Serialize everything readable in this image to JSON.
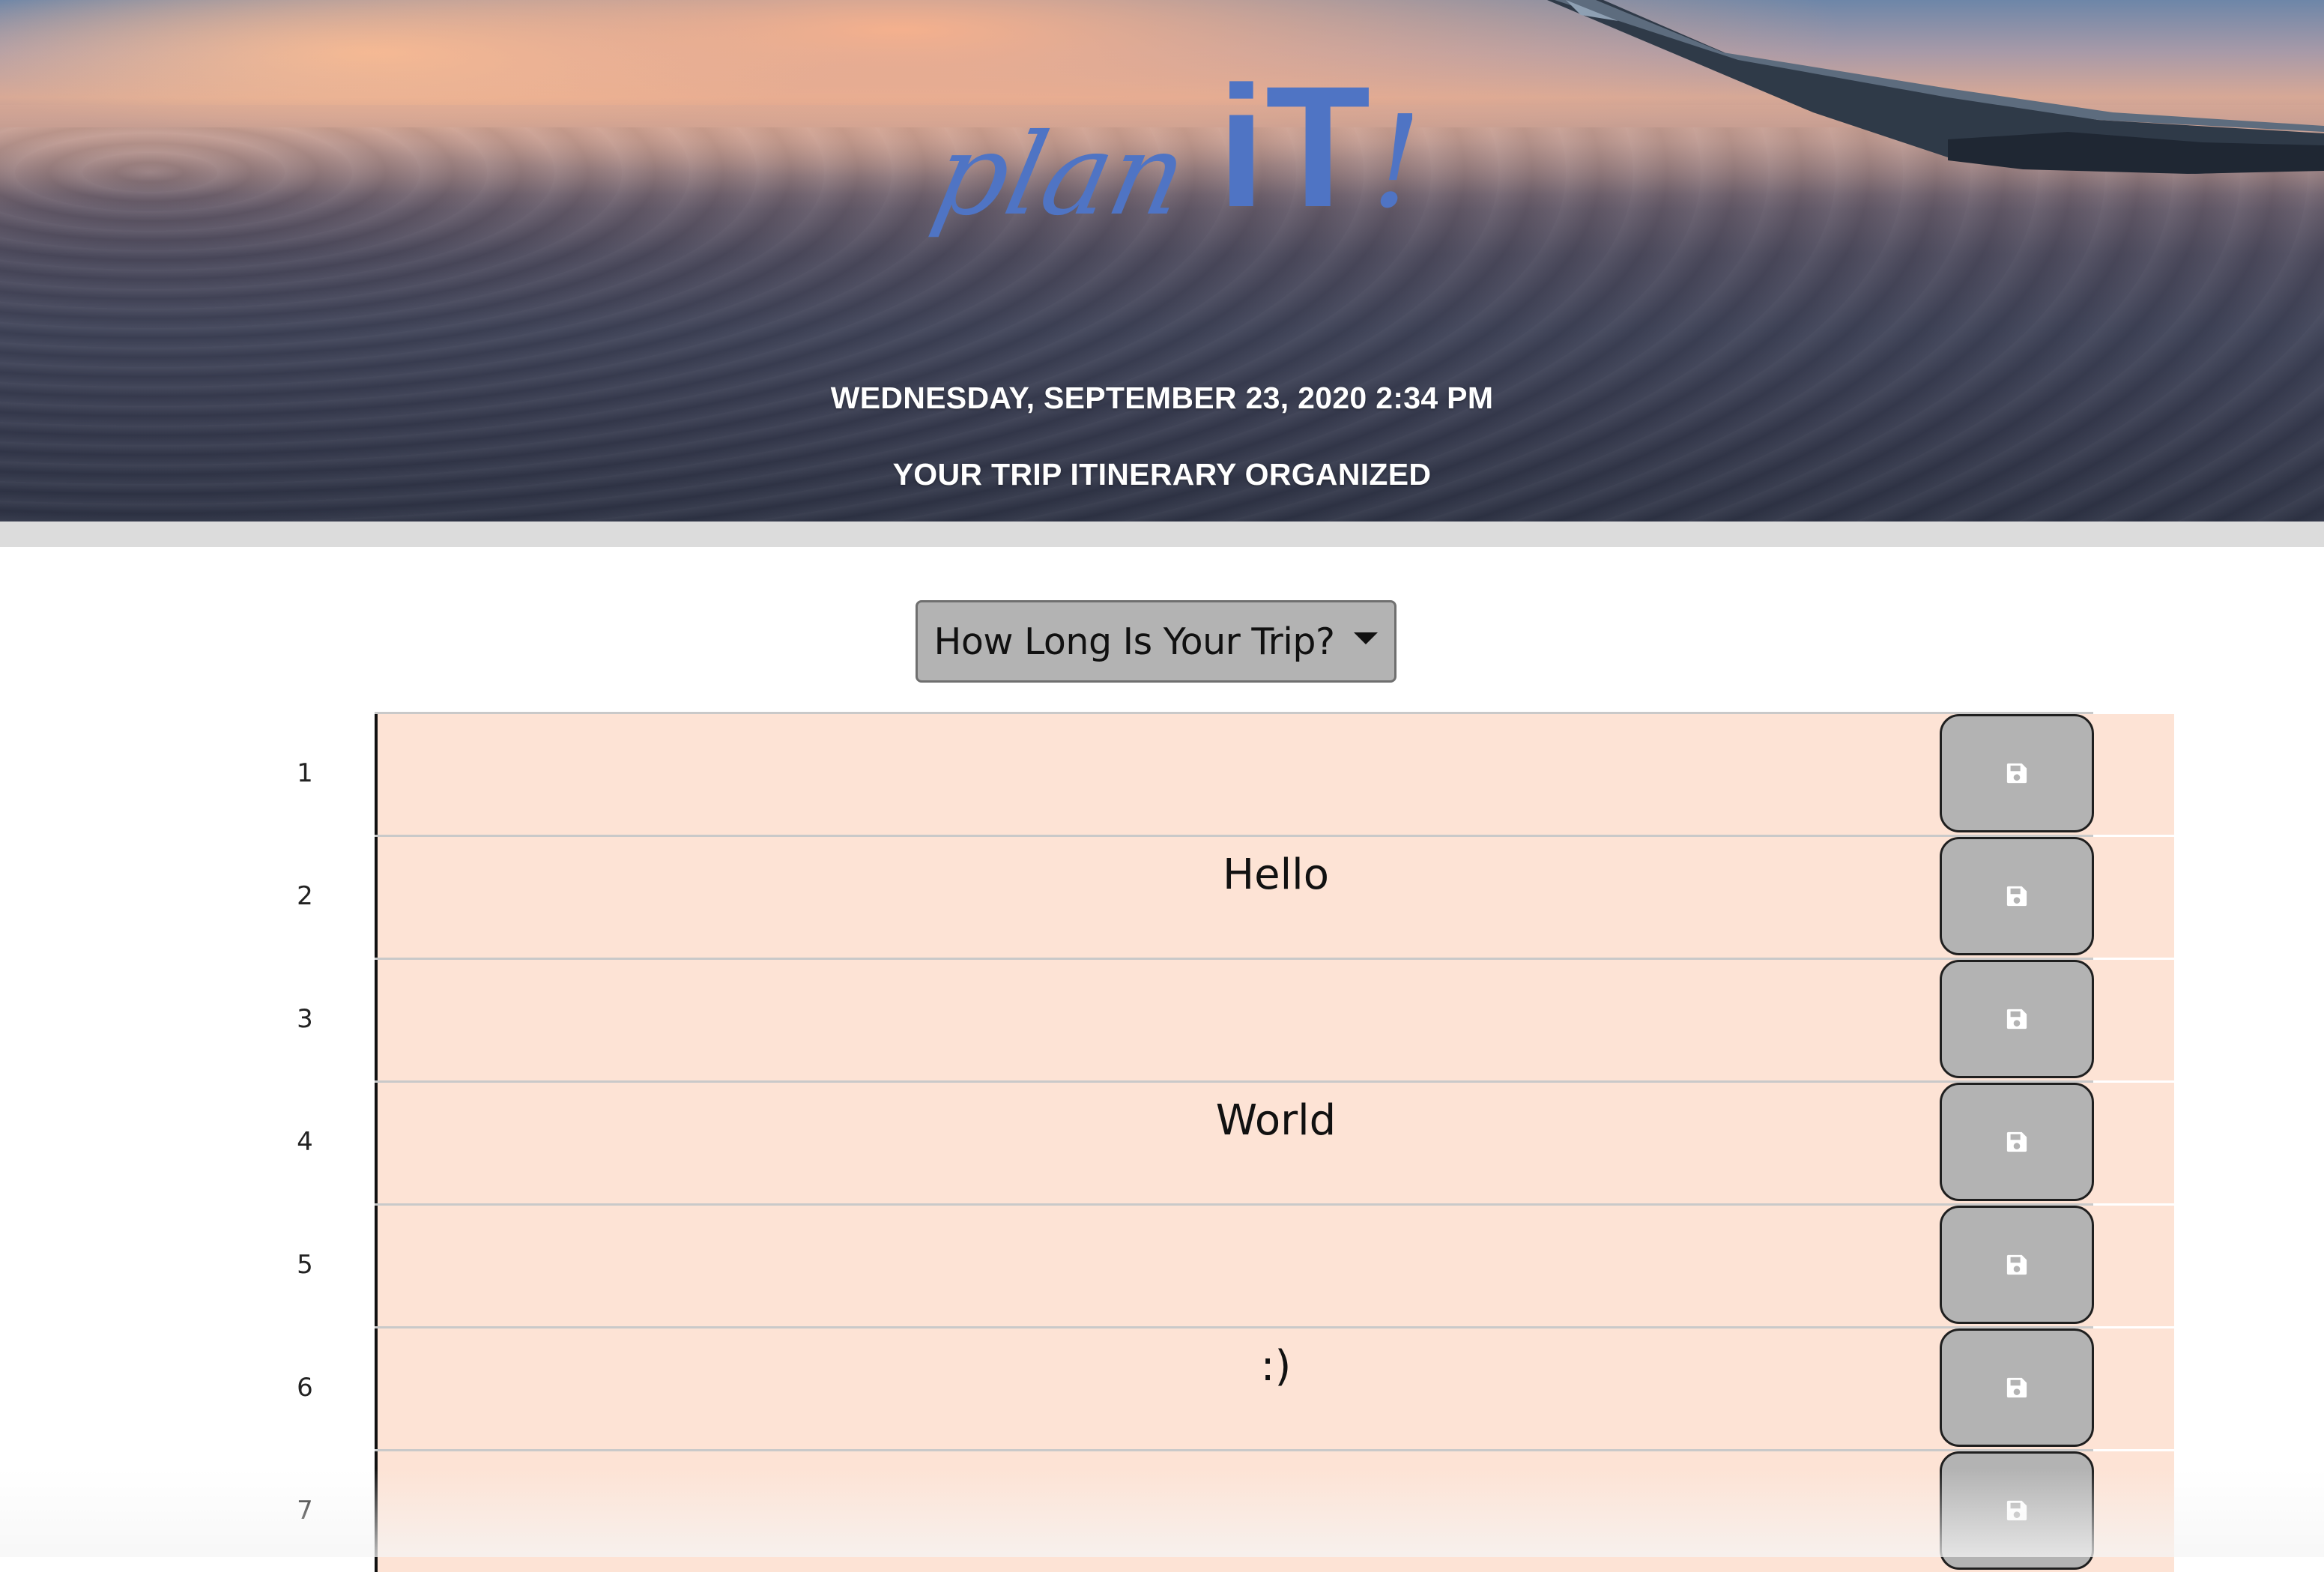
{
  "header": {
    "logo": {
      "script": "plan",
      "block": "iT",
      "mark": "!"
    },
    "date": "WEDNESDAY, SEPTEMBER 23, 2020 2:34 PM",
    "tagline": "YOUR TRIP ITINERARY ORGANIZED"
  },
  "trip_dropdown": {
    "label": "How Long Is Your Trip?"
  },
  "planner": {
    "rows": [
      {
        "day": "1",
        "text": ""
      },
      {
        "day": "2",
        "text": "Hello"
      },
      {
        "day": "3",
        "text": ""
      },
      {
        "day": "4",
        "text": "World"
      },
      {
        "day": "5",
        "text": ""
      },
      {
        "day": "6",
        "text": ":)"
      },
      {
        "day": "7",
        "text": ""
      }
    ],
    "save_icon": "floppy-disk-icon"
  },
  "colors": {
    "logo_blue": "#4f74c4",
    "entry_background": "#fde3d5",
    "button_gray": "#b3b3b3"
  }
}
